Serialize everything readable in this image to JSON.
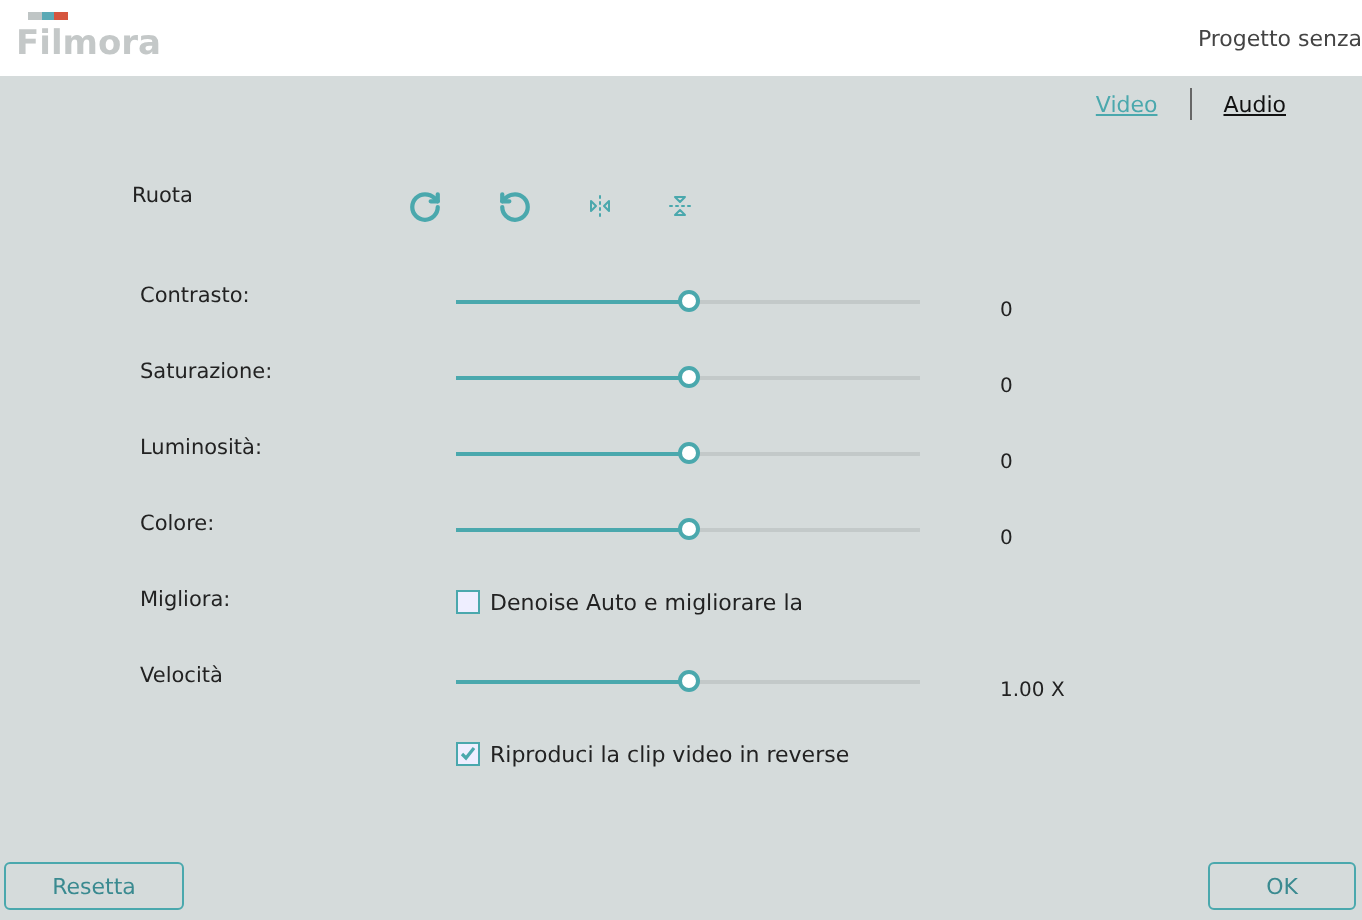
{
  "header": {
    "logo": "Filmora",
    "project_title": "Progetto senza"
  },
  "tabs": [
    {
      "label": "Video",
      "selected": true
    },
    {
      "label": "Audio",
      "selected": false
    }
  ],
  "rotate": {
    "label": "Ruota",
    "actions": [
      {
        "kind": "rotate_cw"
      },
      {
        "kind": "rotate_ccw"
      },
      {
        "kind": "flip_horizontal"
      },
      {
        "kind": "flip_vertical"
      }
    ]
  },
  "adjustments": [
    {
      "kind": "slider",
      "label": "Contrasto:",
      "level": 0.5,
      "reading": "0"
    },
    {
      "kind": "slider",
      "label": "Saturazione:",
      "level": 0.5,
      "reading": "0"
    },
    {
      "kind": "slider",
      "label": "Luminosità:",
      "level": 0.5,
      "reading": "0"
    },
    {
      "kind": "slider",
      "label": "Colore:",
      "level": 0.5,
      "reading": "0"
    },
    {
      "kind": "checkbox",
      "label": "Migliora:",
      "option": "Denoise Auto e migliorare la",
      "checked": false
    },
    {
      "kind": "slider",
      "label": "Velocità",
      "level": 0.5,
      "reading": "1.00 X"
    },
    {
      "kind": "checkbox",
      "option": "Riproduci la clip video in reverse",
      "checked": true
    }
  ],
  "buttons": {
    "reset": "Resetta",
    "ok": "OK"
  }
}
